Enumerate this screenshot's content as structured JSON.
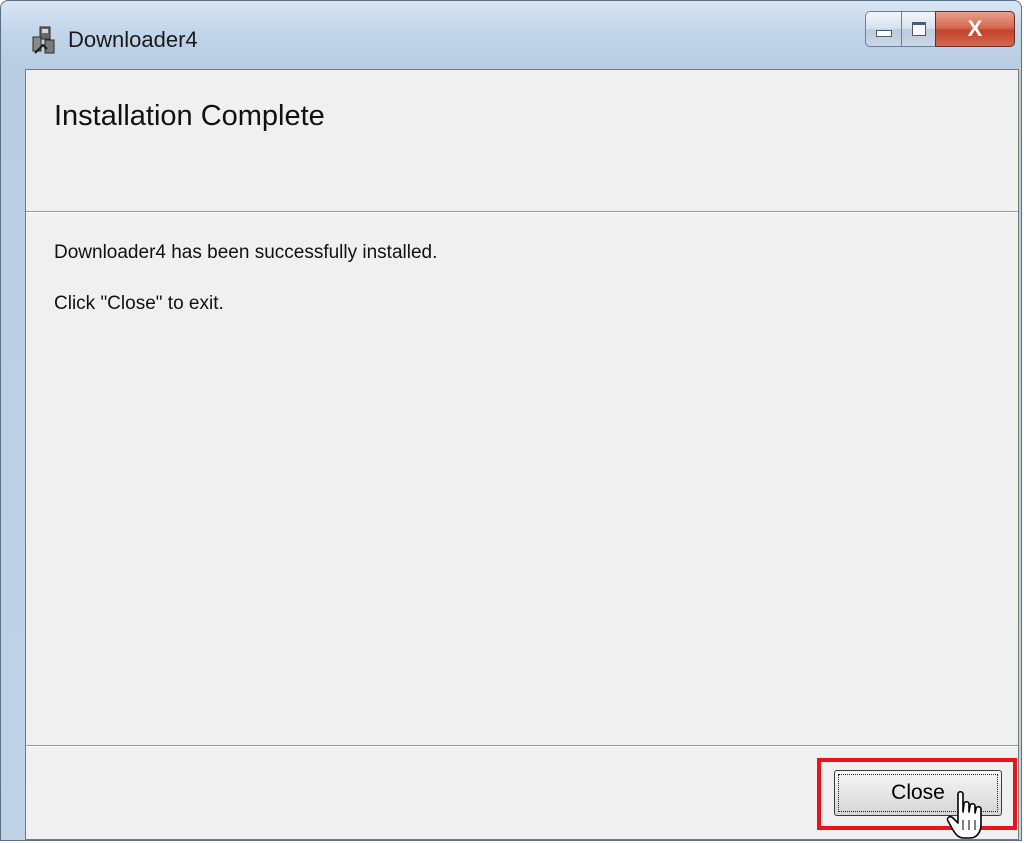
{
  "window": {
    "title": "Downloader4",
    "close_glyph": "X"
  },
  "header": {
    "title": "Installation Complete"
  },
  "body": {
    "message_line1": "Downloader4 has been successfully installed.",
    "message_line2": "Click \"Close\" to exit."
  },
  "footer": {
    "close_label_first": "C",
    "close_label_rest": "lose"
  },
  "icons": {
    "app": "installer-icon",
    "minimize": "minimize-icon",
    "maximize": "maximize-icon",
    "close": "close-icon",
    "pointer": "hand-cursor-icon"
  },
  "colors": {
    "highlight": "#e8141b",
    "close_caption": "#c2432a"
  }
}
